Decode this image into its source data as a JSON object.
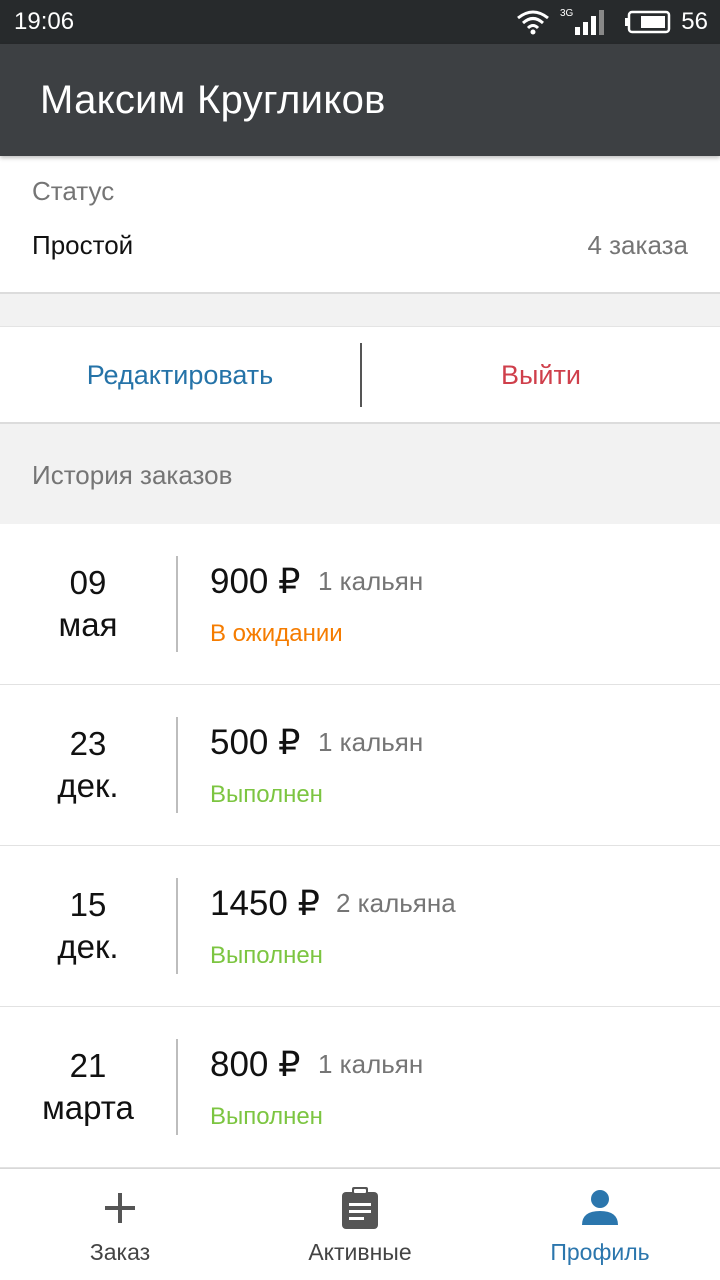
{
  "status_bar": {
    "time": "19:06",
    "network": "3G",
    "battery": "56"
  },
  "header": {
    "title": "Максим Кругликов"
  },
  "profile": {
    "status_label": "Статус",
    "status_value": "Простой",
    "orders_count": "4 заказа"
  },
  "actions": {
    "edit_label": "Редактировать",
    "logout_label": "Выйти"
  },
  "history": {
    "title": "История заказов",
    "orders": [
      {
        "day": "09",
        "month": "мая",
        "price": "900 ₽",
        "qty": "1 кальян",
        "status": "В ожидании",
        "status_color": "#f57c00"
      },
      {
        "day": "23",
        "month": "дек.",
        "price": "500 ₽",
        "qty": "1 кальян",
        "status": "Выполнен",
        "status_color": "#7cc541"
      },
      {
        "day": "15",
        "month": "дек.",
        "price": "1450 ₽",
        "qty": "2 кальяна",
        "status": "Выполнен",
        "status_color": "#7cc541"
      },
      {
        "day": "21",
        "month": "марта",
        "price": "800 ₽",
        "qty": "1 кальян",
        "status": "Выполнен",
        "status_color": "#7cc541"
      }
    ]
  },
  "nav": {
    "items": [
      {
        "label": "Заказ",
        "icon": "plus-icon"
      },
      {
        "label": "Активные",
        "icon": "clipboard-icon"
      },
      {
        "label": "Профиль",
        "icon": "person-icon",
        "active": true
      }
    ],
    "active_color": "#2b76ad"
  }
}
